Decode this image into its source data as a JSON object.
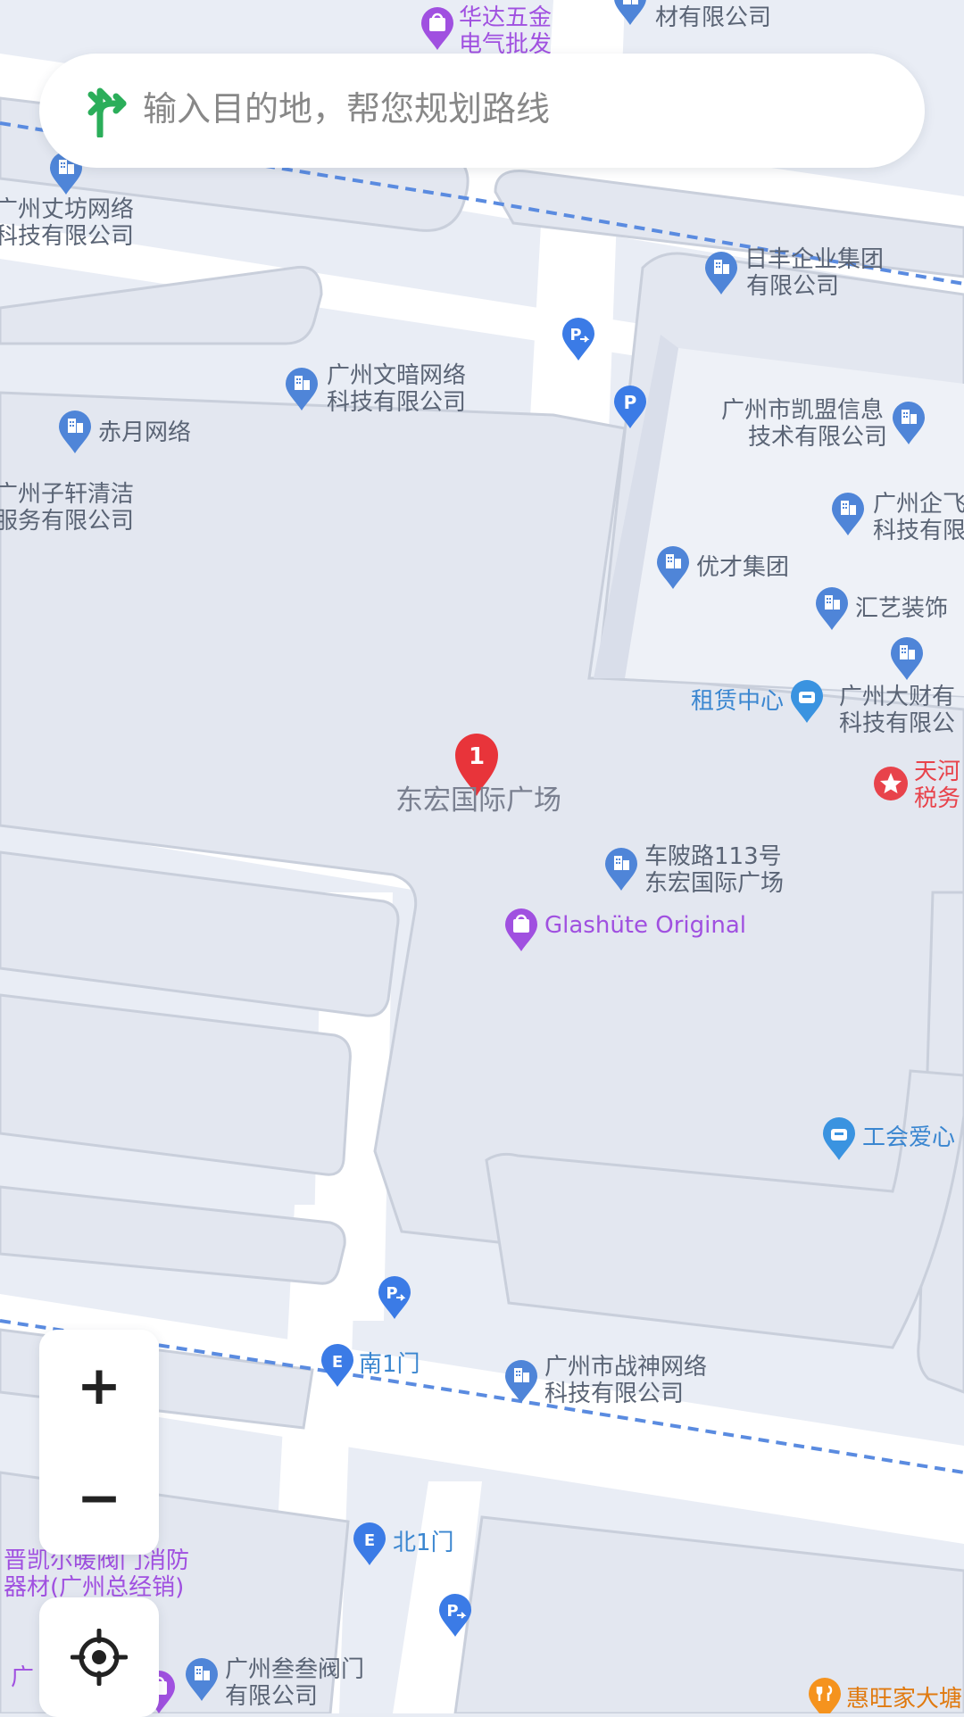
{
  "search": {
    "placeholder": "输入目的地，帮您规划路线"
  },
  "marker": {
    "number": "1",
    "label": "东宏国际广场"
  },
  "pois": {
    "huada": "华达五金",
    "huada2": "电气批发",
    "top_right": "材有限公司",
    "wenfang1": "广州丈坊网络",
    "wenfang2": "科技有限公司",
    "rifeng1": "日丰企业集团",
    "rifeng2": "有限公司",
    "wenan1": "广州文暗网络",
    "wenan2": "科技有限公司",
    "chiyue": "赤月网络",
    "kaimeng1": "广州市凯盟信息",
    "kaimeng2": "技术有限公司",
    "zixuan1": "广州子轩清洁",
    "zixuan2": "服务有限公司",
    "qifei1": "广州企飞",
    "qifei2": "科技有限",
    "youcai": "优才集团",
    "huiyi": "汇艺装饰",
    "zulin": "租赁中心",
    "dacai1": "广州大财有",
    "dacai2": "科技有限公",
    "tianhe1": "天河",
    "tianhe2": "税务",
    "chepo1": "车陂路113号",
    "chepo2": "东宏国际广场",
    "glashute": "Glashüte Original",
    "gonghui": "工会爱心",
    "nan1men": "南1门",
    "zhanshen1": "广州市战神网络",
    "zhanshen2": "科技有限公司",
    "bei1men": "北1门",
    "jinkai1": "晋凯尔暖阀门消防",
    "jinkai2": "器材(广州总经销)",
    "sansan1": "广州叁叁阀门",
    "sansan2": "有限公司",
    "huiwang": "惠旺家大塘",
    "guang": "广"
  },
  "controls": {
    "zoom_in": "+",
    "zoom_out": "−"
  },
  "colors": {
    "building": "#e5e9f2",
    "road": "#ffffff",
    "poi_blue": "#4f85d8",
    "poi_purple": "#a050e0",
    "poi_red": "#e8434b",
    "poi_orange": "#f5931e",
    "label_gray": "#5a6475",
    "marker_red": "#e8343a",
    "search_arrow": "#2bae5a"
  }
}
